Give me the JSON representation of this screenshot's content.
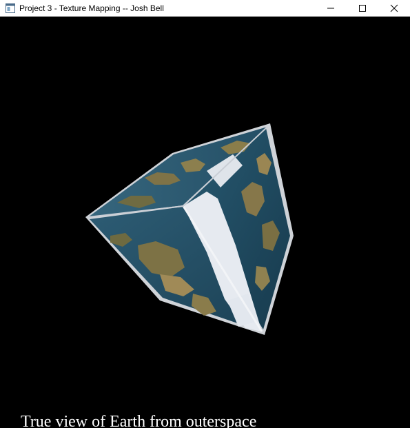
{
  "window": {
    "title": "Project 3 - Texture Mapping -- Josh Bell",
    "icon": "app-window-icon",
    "controls": [
      "minimize-icon",
      "maximize-icon",
      "close-icon"
    ]
  },
  "scene": {
    "subject": "textured-earth-cube",
    "background_color": "#000000",
    "ocean_color": "#1f4d63",
    "land_color": "#8a7a4a",
    "ice_color": "#e8ecf2"
  },
  "caption": {
    "text": "True view of Earth from outerspace"
  }
}
